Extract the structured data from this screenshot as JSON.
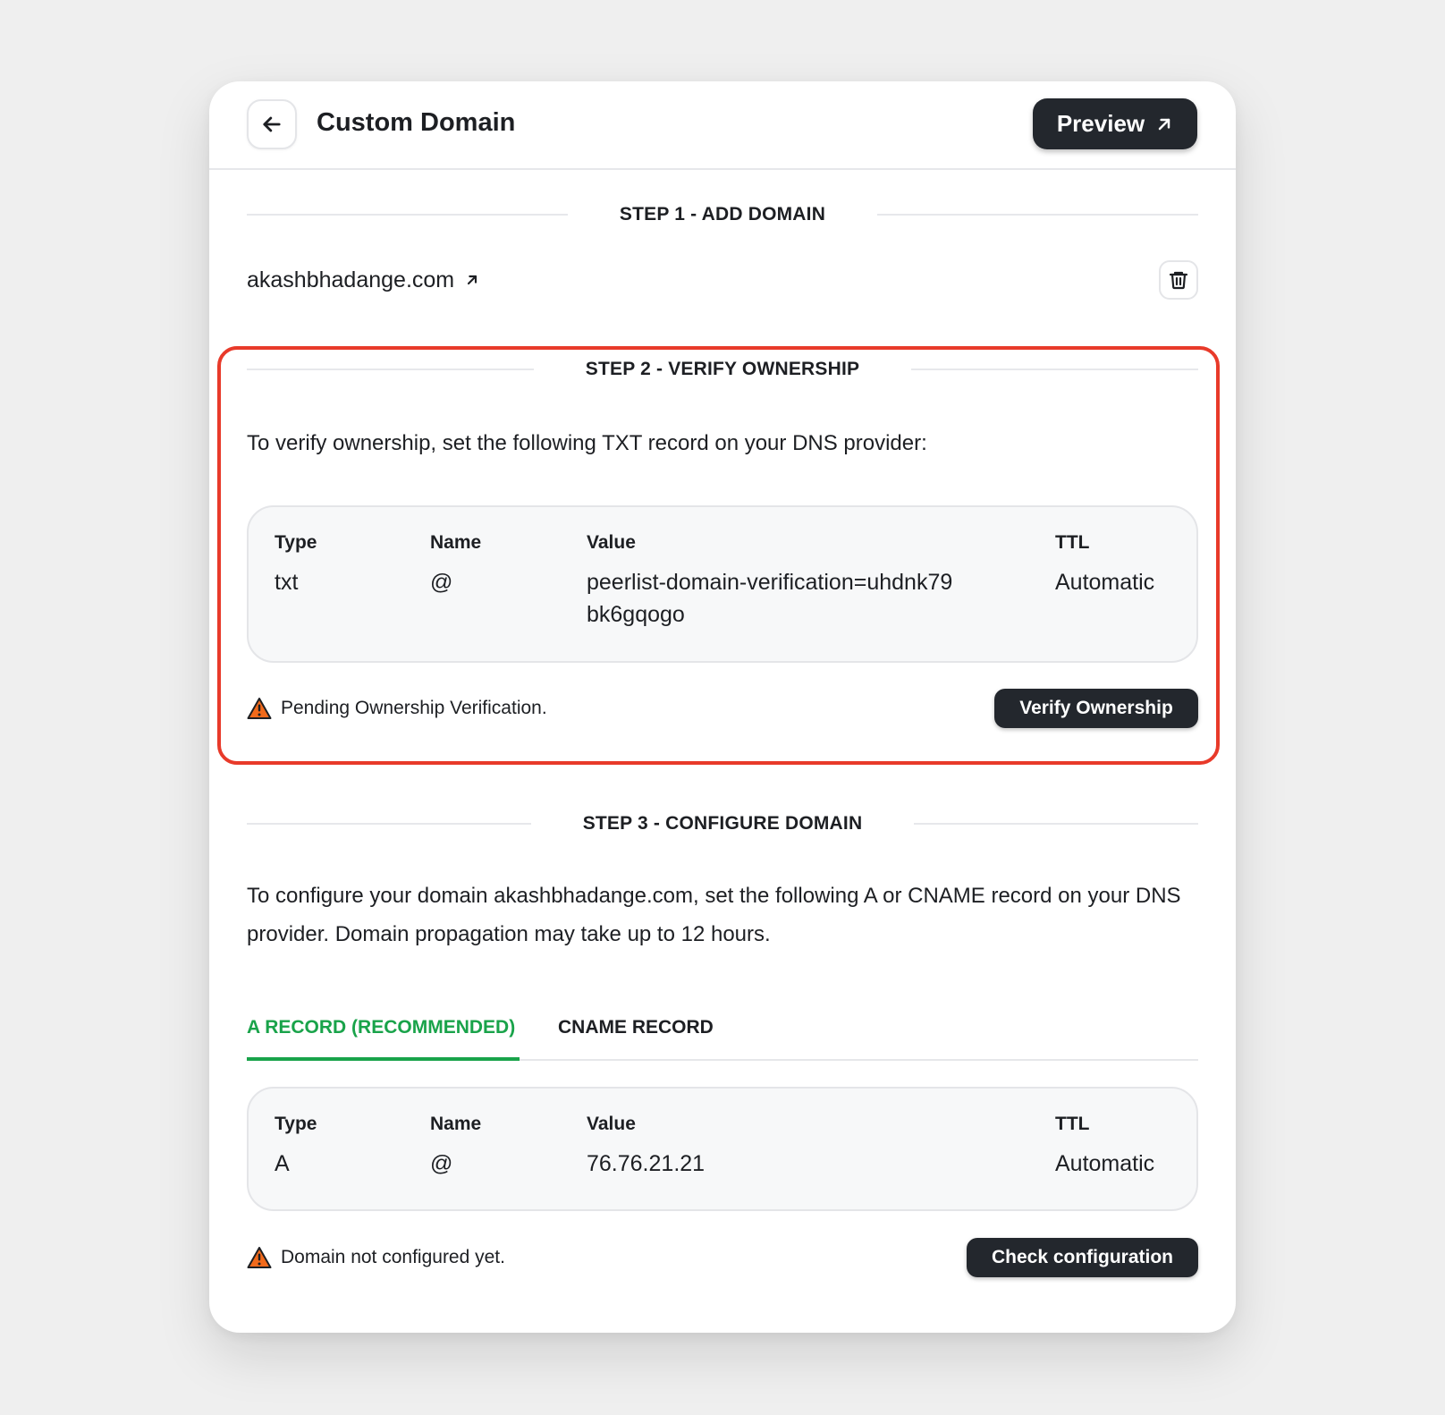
{
  "header": {
    "title": "Custom Domain",
    "preview_label": "Preview"
  },
  "step1": {
    "heading": "STEP 1 - ADD DOMAIN",
    "domain": "akashbhadange.com"
  },
  "step2": {
    "heading": "STEP 2 - VERIFY OWNERSHIP",
    "instruction": "To verify ownership, set the following TXT record on your DNS provider:",
    "record": {
      "headers": [
        "Type",
        "Name",
        "Value",
        "TTL"
      ],
      "values": [
        "txt",
        "@",
        "peerlist-domain-verification=uhdnk79bk6gqogo",
        "Automatic"
      ]
    },
    "status": "Pending Ownership Verification.",
    "button_label": "Verify Ownership"
  },
  "step3": {
    "heading": "STEP 3 - CONFIGURE DOMAIN",
    "instruction": "To configure your domain akashbhadange.com, set the following A or CNAME record on your DNS provider. Domain propagation may take up to 12 hours.",
    "tabs": [
      "A RECORD (RECOMMENDED)",
      "CNAME RECORD"
    ],
    "record": {
      "headers": [
        "Type",
        "Name",
        "Value",
        "TTL"
      ],
      "values": [
        "A",
        "@",
        "76.76.21.21",
        "Automatic"
      ]
    },
    "status": "Domain not configured yet.",
    "button_label": "Check configuration"
  },
  "colors": {
    "accent_green": "#19a34a",
    "highlight_red": "#e83a2a",
    "warning_orange": "#f26a1b",
    "button_dark": "#23272d"
  }
}
